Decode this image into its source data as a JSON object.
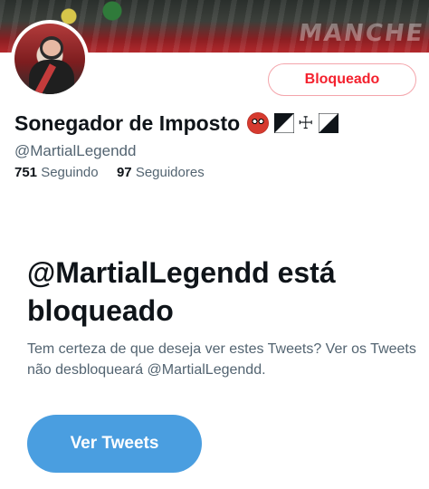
{
  "header": {
    "banner_text": "MANCHE"
  },
  "profile": {
    "blocked_button_label": "Bloqueado",
    "display_name": "Sonegador de Imposto",
    "name_emoji": "ogre-emoji",
    "name_cross_glyph": "☩",
    "handle": "@MartialLegendd",
    "following_count": "751",
    "following_label": "Seguindo",
    "followers_count": "97",
    "followers_label": "Seguidores"
  },
  "blocked_notice": {
    "title": "@MartialLegendd está bloqueado",
    "description": "Tem certeza de que deseja ver estes Tweets? Ver os Tweets não desbloqueará @MartialLegendd.",
    "view_button_label": "Ver Tweets"
  },
  "colors": {
    "blocked_red": "#f4212e",
    "blocked_border": "#f4a5ab",
    "primary_blue": "#4a9ee0",
    "secondary_text": "#536471",
    "primary_text": "#0f1419"
  }
}
